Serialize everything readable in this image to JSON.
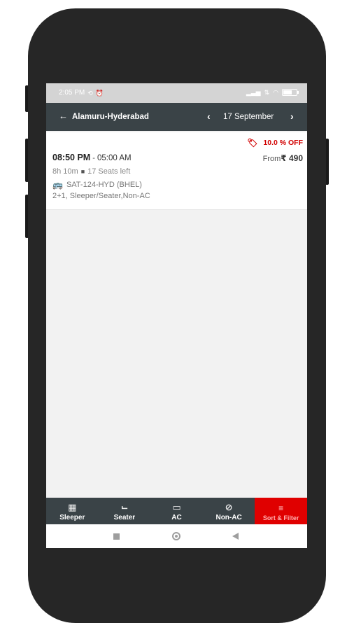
{
  "status_bar": {
    "time": "2:05 PM"
  },
  "header": {
    "route": "Alamuru-Hyderabad",
    "date": "17 September"
  },
  "results": [
    {
      "offer": "10.0 % OFF",
      "departure": "08:50 PM",
      "separator": " - ",
      "arrival": "05:00 AM",
      "fare_prefix": "From",
      "fare": "₹ 490",
      "duration": "8h 10m",
      "seats": "17 Seats left",
      "bus_name": "SAT-124-HYD (BHEL)",
      "bus_type": "2+1, Sleeper/Seater,Non-AC"
    }
  ],
  "filters": [
    {
      "label": "Sleeper",
      "icon": "sleeper-icon"
    },
    {
      "label": "Seater",
      "icon": "seater-icon"
    },
    {
      "label": "AC",
      "icon": "ac-icon"
    },
    {
      "label": "Non-AC",
      "icon": "non-ac-icon"
    },
    {
      "label": "Sort & Filter",
      "icon": "filter-icon"
    }
  ],
  "colors": {
    "header_bg": "#3a4347",
    "accent_red": "#e00000",
    "offer_red": "#d10000",
    "phone_body": "#262626"
  }
}
